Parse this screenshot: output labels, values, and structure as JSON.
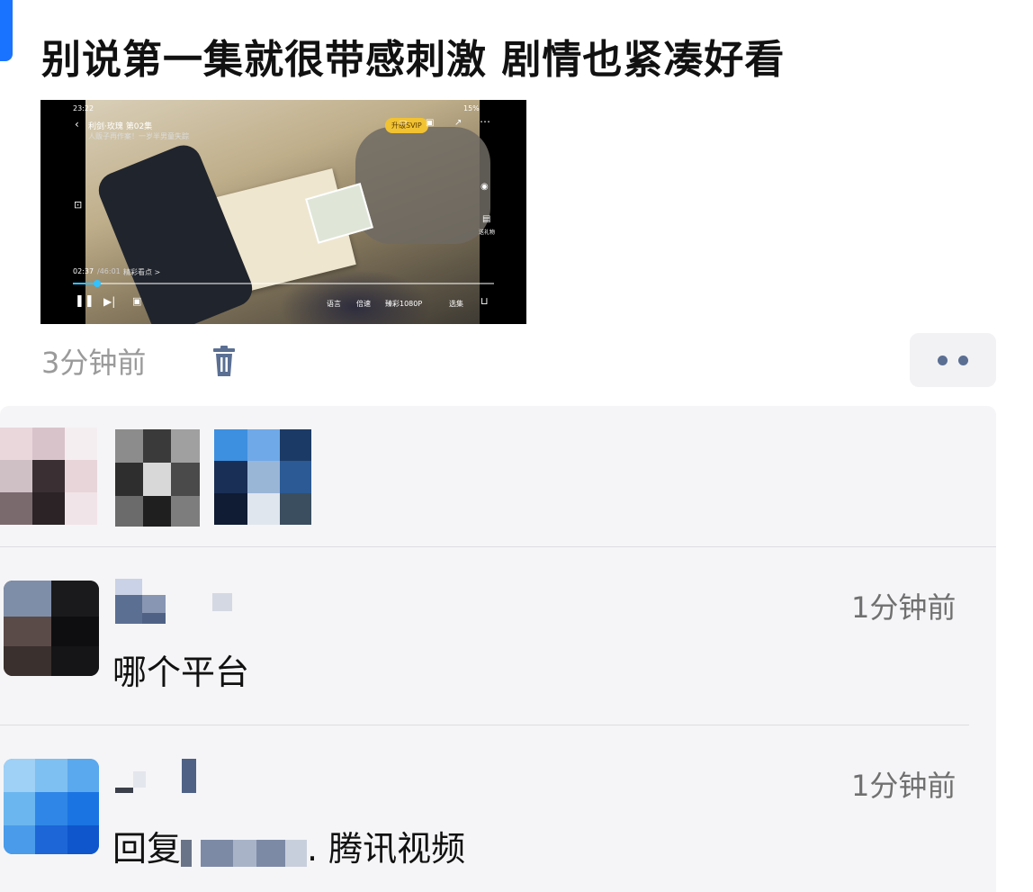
{
  "post": {
    "title": "别说第一集就很带感刺激 剧情也紧凑好看",
    "time_ago": "3分钟前"
  },
  "video": {
    "status_time": "23:22",
    "battery": "15%",
    "show_title": "利剑·玫瑰 第02集",
    "subtitle": "人贩子再作案！一岁半男童失踪",
    "vip_label": "升级SVIP",
    "side_label": "送礼物",
    "elapsed": "02:37",
    "duration": "/46:01",
    "highlights_label": "精彩看点 >",
    "progress": 0.057,
    "controls": {
      "language": "语言",
      "speed": "倍速",
      "quality": "臻彩1080P",
      "episodes": "选集"
    }
  },
  "comments": [
    {
      "time": "1分钟前",
      "text": "哪个平台"
    },
    {
      "time": "1分钟前",
      "reply_prefix": "回复",
      "text": ". 腾讯视频"
    }
  ],
  "colors": {
    "accent": "#1a73ff",
    "more_dots": "#5b6f93",
    "trash": "#5b6f93",
    "progress": "#30c3ff"
  },
  "icons": [
    "trash-icon",
    "more-dots-icon",
    "back-icon",
    "play-pause-icon",
    "next-episode-icon",
    "camera-icon",
    "gift-icon",
    "lock-icon"
  ]
}
